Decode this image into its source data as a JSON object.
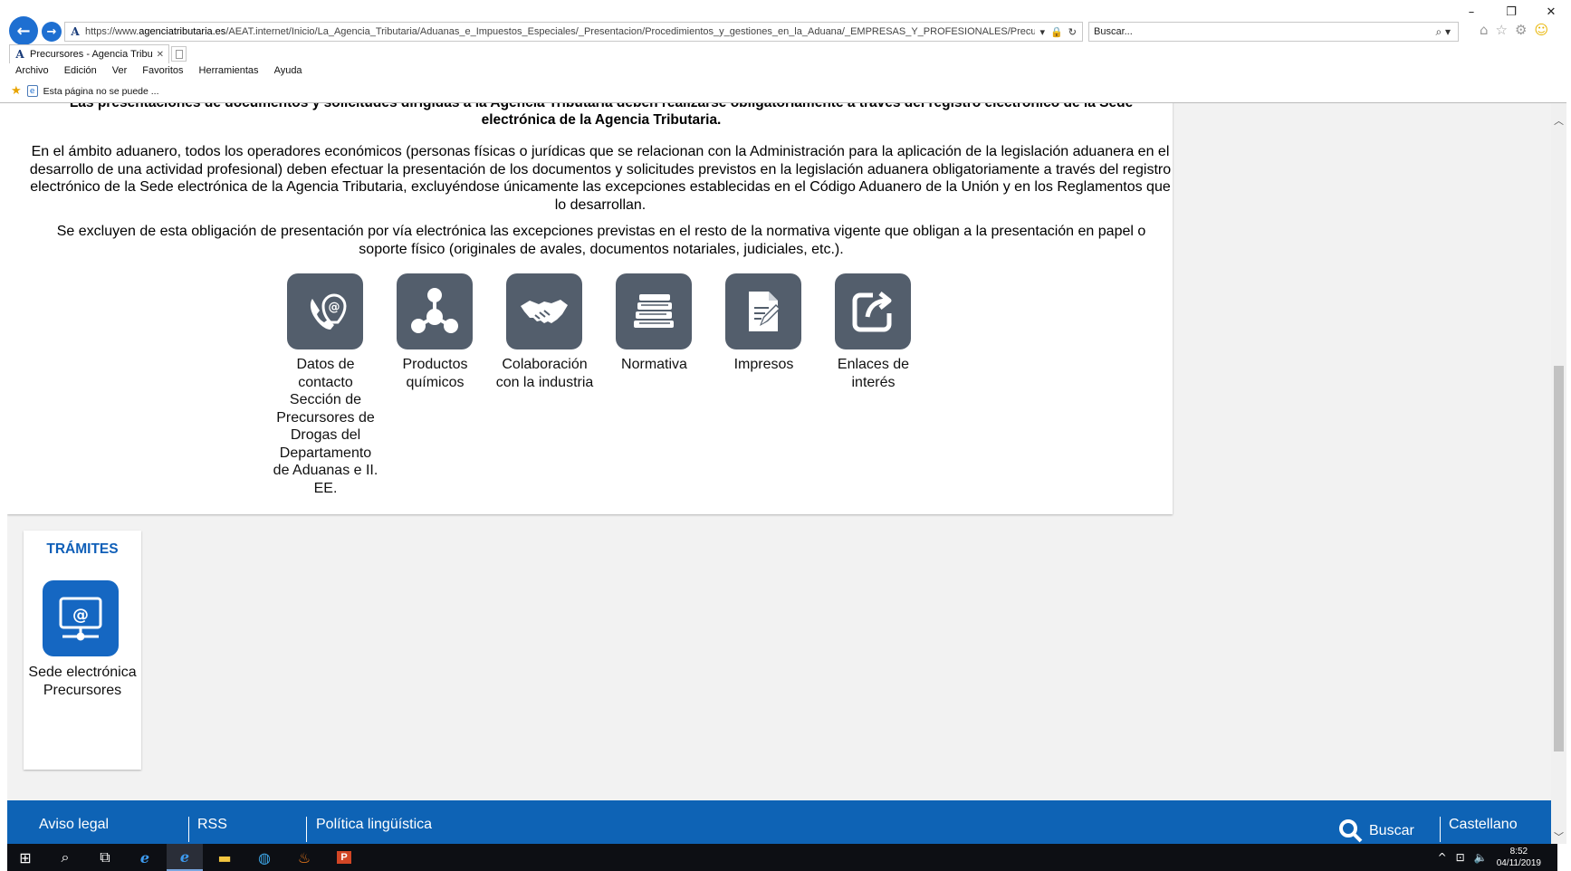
{
  "browser": {
    "window_controls": {
      "minimize": "–",
      "restore": "❐",
      "close": "✕"
    },
    "url_prefix": "https://www.",
    "url_domain": "agenciatributaria.es",
    "url_rest": "/AEAT.internet/Inicio/La_Agencia_Tributaria/Aduanas_e_Impuestos_Especiales/_Presentacion/Procedimientos_y_gestiones_en_la_Aduana/_EMPRESAS_Y_PROFESIONALES/Precursores/Precurs",
    "search_placeholder": "Buscar...",
    "tab_title": "Precursores - Agencia Tribu...",
    "menu": [
      "Archivo",
      "Edición",
      "Ver",
      "Favoritos",
      "Herramientas",
      "Ayuda"
    ],
    "favorites_item": "Esta página no se puede ..."
  },
  "content": {
    "notice": "Las presentaciones de documentos y solicitudes dirigidas a la Agencia Tributaria deben realizarse obligatoriamente a través del registro electrónico de la Sede electrónica de la Agencia Tributaria.",
    "paragraph1": "En el ámbito aduanero, todos los operadores económicos (personas físicas o jurídicas que se relacionan con la Administración para la aplicación de la legislación aduanera en el desarrollo de una actividad profesional) deben efectuar la presentación de los documentos y solicitudes previstos en la legislación aduanera obligatoriamente a través del registro electrónico de la Sede electrónica de la Agencia Tributaria, excluyéndose únicamente las excepciones establecidas en el Código Aduanero de la Unión y en los Reglamentos que lo desarrollan.",
    "paragraph2": "Se excluyen de esta obligación de presentación por vía electrónica las excepciones previstas en el resto de la normativa vigente que obligan a la presentación en papel o soporte físico (originales de avales, documentos notariales, judiciales, etc.).",
    "icons": [
      {
        "label": "Datos de contacto Sección de Precursores de Drogas del Departamento de Aduanas e II. EE.",
        "icon": "contact-icon"
      },
      {
        "label": "Productos químicos",
        "icon": "molecule-icon"
      },
      {
        "label": "Colaboración con la industria",
        "icon": "handshake-icon"
      },
      {
        "label": "Normativa",
        "icon": "books-icon"
      },
      {
        "label": "Impresos",
        "icon": "form-icon"
      },
      {
        "label": "Enlaces de interés",
        "icon": "external-link-icon"
      }
    ],
    "icon_color": "#535e6c"
  },
  "tramites": {
    "title": "TRÁMITES",
    "item_label": "Sede electrónica Precursores",
    "icon": "computer-at-icon",
    "color": "#1567c2"
  },
  "footer": {
    "links": [
      "Aviso legal",
      "RSS",
      "Política lingüística"
    ],
    "search_label": "Buscar",
    "language": "Castellano",
    "color": "#0e63b5"
  },
  "taskbar": {
    "time": "8:52",
    "date": "04/11/2019"
  }
}
